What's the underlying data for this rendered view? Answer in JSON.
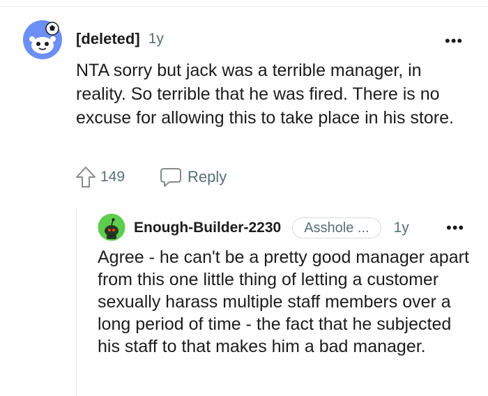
{
  "comment": {
    "username": "[deleted]",
    "time": "1y",
    "more_icon": "•••",
    "body": "NTA sorry but jack was a terrible manager, in reality. So terrible that he was fired. There is no excuse for allowing this to take place in his store.",
    "score": "149",
    "reply_label": "Reply"
  },
  "reply": {
    "username": "Enough-Builder-2230",
    "flair": "Asshole ...",
    "time": "1y",
    "more_icon": "•••",
    "body": "Agree - he can't be a pretty good manager apart from this one little thing of letting a customer sexually harass multiple staff members over a long period of time - the fact that he subjected his staff to that makes him a bad manager."
  },
  "colors": {
    "avatar1_bg": "#6b8ff5",
    "avatar2_bg": "#5ccd4c",
    "meta_text": "#576f76",
    "thread_line": "#e3e6e8"
  }
}
